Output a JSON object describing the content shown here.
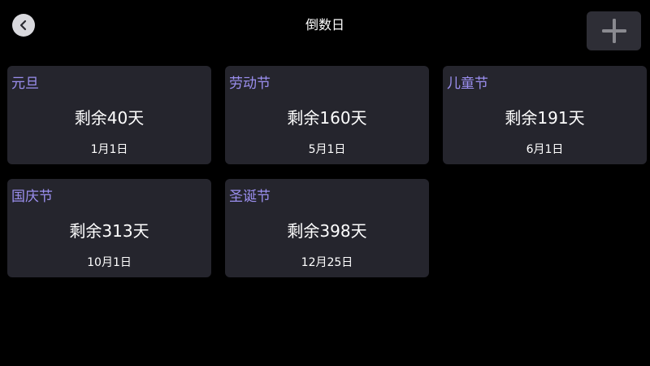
{
  "header": {
    "title": "倒数日",
    "back_icon": "chevron-left-icon",
    "add_icon": "plus-icon"
  },
  "colors": {
    "background": "#000000",
    "card_background": "#25252d",
    "card_title": "#9b8fef",
    "text": "#ffffff",
    "add_button_background": "#2e2e36",
    "add_icon": "#8a8a90",
    "back_button_background": "#d9d9de"
  },
  "events": [
    {
      "name": "元旦",
      "remaining": "剩余40天",
      "date": "1月1日"
    },
    {
      "name": "劳动节",
      "remaining": "剩余160天",
      "date": "5月1日"
    },
    {
      "name": "儿童节",
      "remaining": "剩余191天",
      "date": "6月1日"
    },
    {
      "name": "国庆节",
      "remaining": "剩余313天",
      "date": "10月1日"
    },
    {
      "name": "圣诞节",
      "remaining": "剩余398天",
      "date": "12月25日"
    }
  ]
}
